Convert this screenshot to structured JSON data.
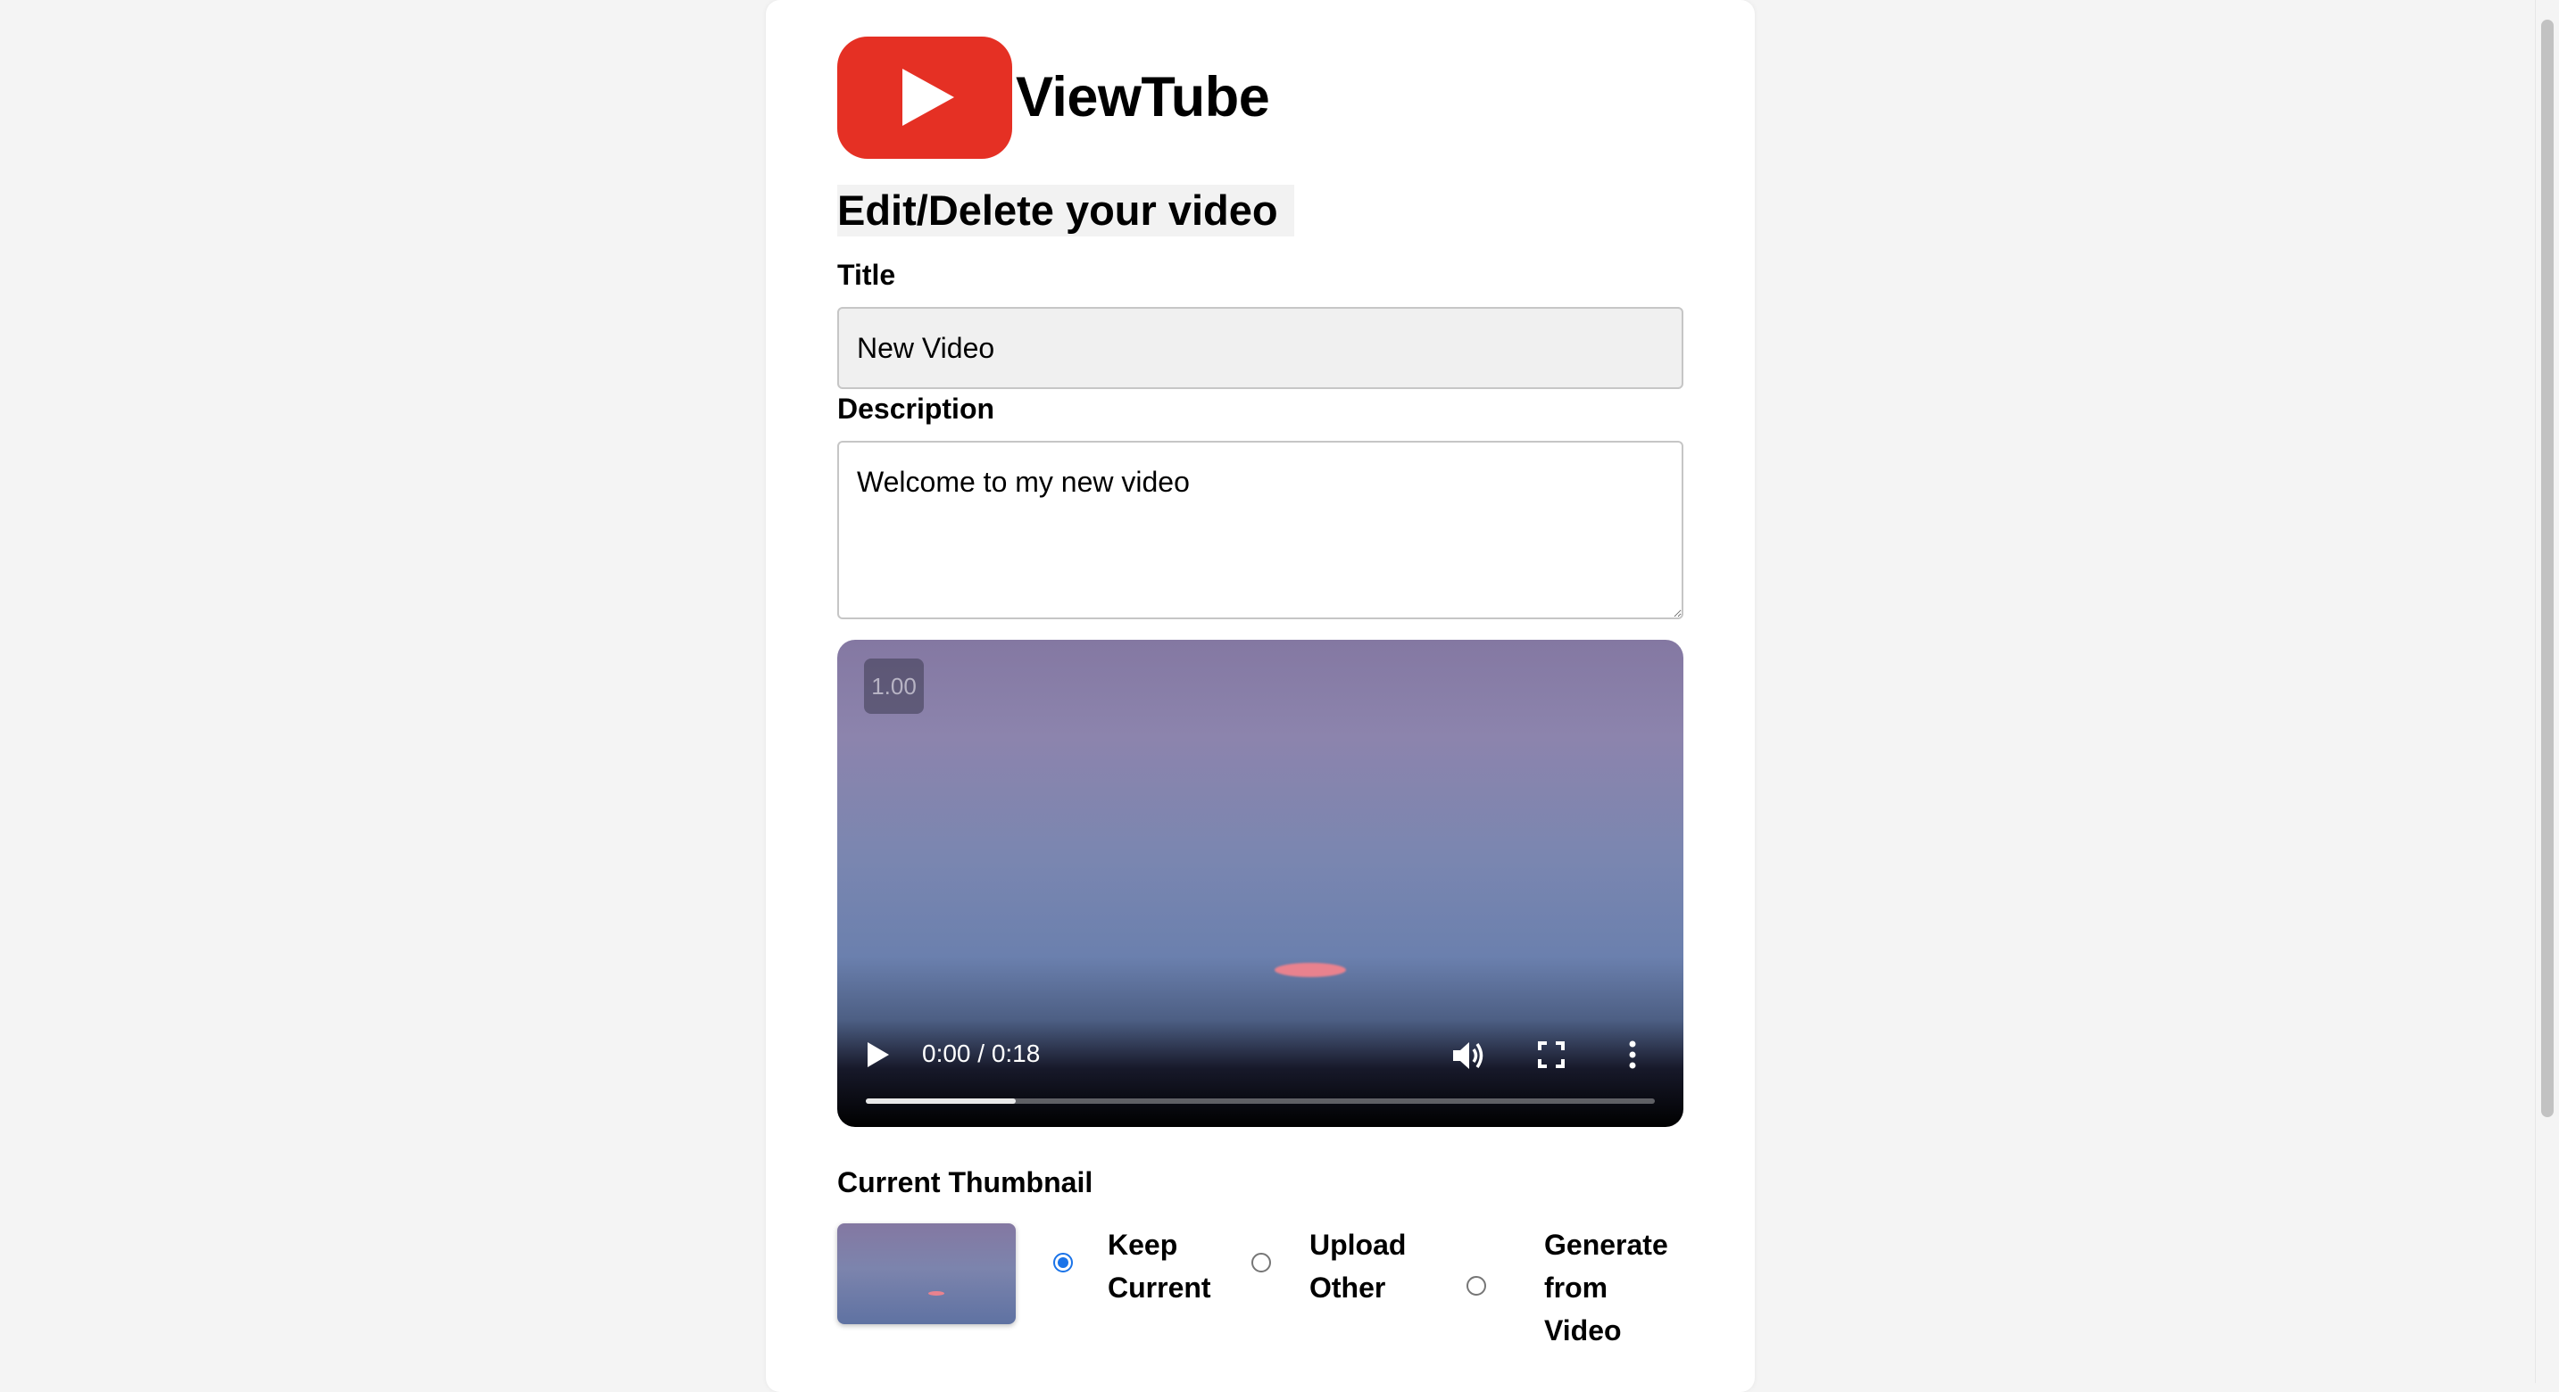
{
  "app": {
    "name": "ViewTube",
    "brand_color": "#e53024"
  },
  "page": {
    "heading": "Edit/Delete your video"
  },
  "form": {
    "title_label": "Title",
    "title_value": "New Video",
    "description_label": "Description",
    "description_value": "Welcome to my new video"
  },
  "video": {
    "speed_badge": "1.00",
    "time_display": "0:00 / 0:18",
    "progress_fraction": 0.19
  },
  "thumbnail": {
    "label": "Current Thumbnail",
    "options": [
      {
        "label": "Keep Current",
        "checked": true
      },
      {
        "label": "Upload Other",
        "checked": false
      },
      {
        "label": "Generate from Video",
        "checked": false
      }
    ]
  },
  "icons": {
    "logo": "play-logo-icon",
    "play": "play-icon",
    "volume": "volume-icon",
    "fullscreen": "fullscreen-icon",
    "more": "more-vert-icon"
  }
}
